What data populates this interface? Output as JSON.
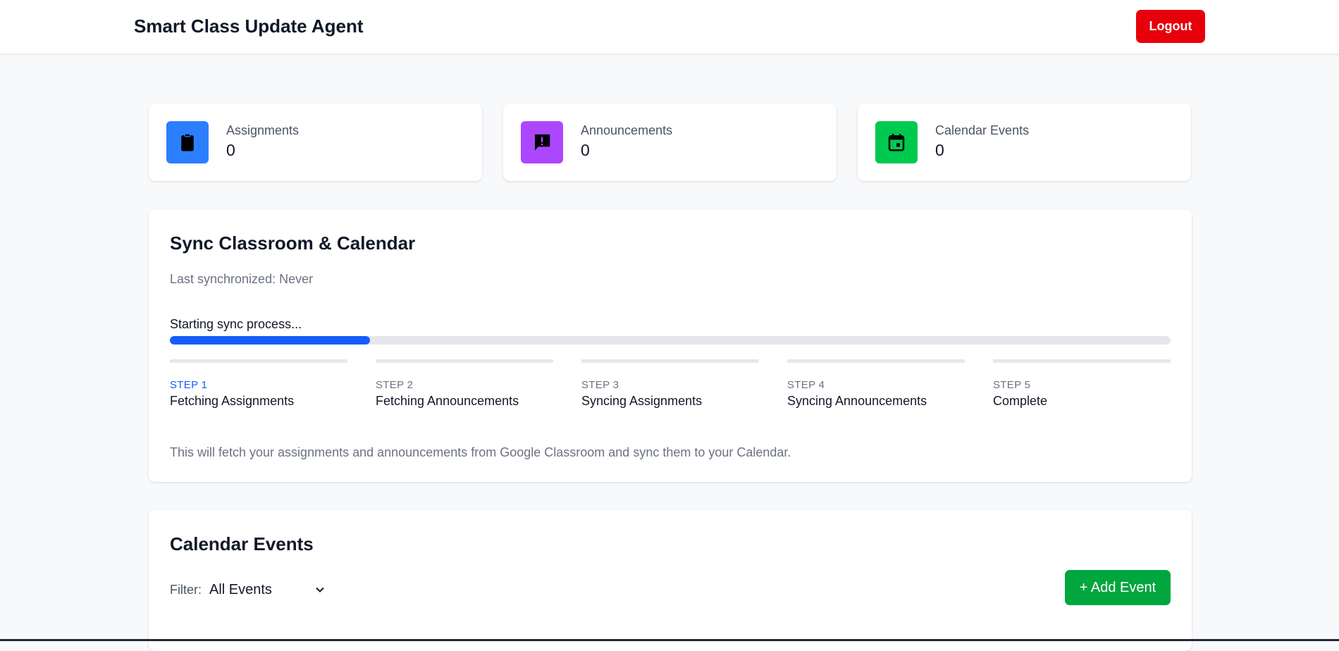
{
  "header": {
    "title": "Smart Class Update Agent",
    "logout_label": "Logout",
    "logout_color": "#e7000b"
  },
  "stats": [
    {
      "label": "Assignments",
      "value": "0",
      "icon": "clipboard-icon",
      "color": "#2b7fff"
    },
    {
      "label": "Announcements",
      "value": "0",
      "icon": "message-alert-icon",
      "color": "#ad46ff"
    },
    {
      "label": "Calendar Events",
      "value": "0",
      "icon": "calendar-icon",
      "color": "#00c950"
    }
  ],
  "sync": {
    "title": "Sync Classroom & Calendar",
    "last_synchronized": "Last synchronized: Never",
    "progress_text": "Starting sync process...",
    "progress_fraction": 0.2,
    "progress_color": "#155dfc",
    "steps": [
      {
        "number": "STEP 1",
        "name": "Fetching Assignments",
        "active": true
      },
      {
        "number": "STEP 2",
        "name": "Fetching Announcements",
        "active": false
      },
      {
        "number": "STEP 3",
        "name": "Syncing Assignments",
        "active": false
      },
      {
        "number": "STEP 4",
        "name": "Syncing Announcements",
        "active": false
      },
      {
        "number": "STEP 5",
        "name": "Complete",
        "active": false
      }
    ],
    "description": "This will fetch your assignments and announcements from Google Classroom and sync them to your Calendar."
  },
  "events": {
    "title": "Calendar Events",
    "filter_label": "Filter:",
    "filter_value": "All Events",
    "add_button_label": "+ Add Event",
    "add_button_color": "#00a63e"
  }
}
